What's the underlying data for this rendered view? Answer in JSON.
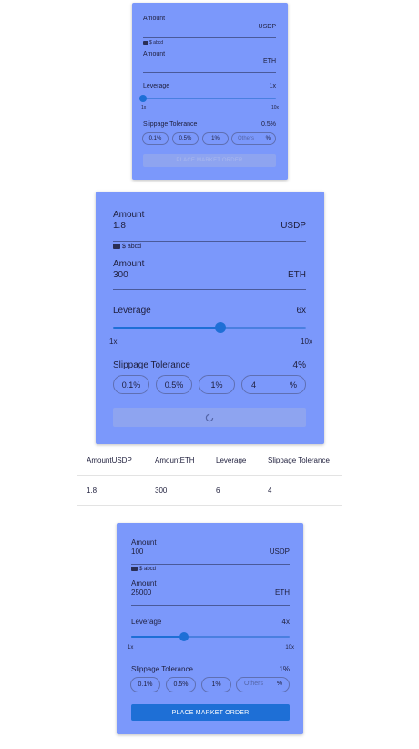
{
  "card1": {
    "amount1_label": "Amount",
    "amount1_value": "",
    "amount1_currency": "USDP",
    "wallet_text": "$ abcd",
    "amount2_label": "Amount",
    "amount2_value": "",
    "amount2_currency": "ETH",
    "leverage_label": "Leverage",
    "leverage_value": "1x",
    "leverage_level": 1,
    "slider_min": "1x",
    "slider_max": "10x",
    "slippage_label": "Slippage Tolerance",
    "slippage_value": "0.5%",
    "options": [
      "0.1%",
      "0.5%",
      "1%"
    ],
    "others_placeholder": "Others",
    "others_value": "",
    "percent_sign": "%",
    "button_label": "PLACE MARKET ORDER",
    "button_state": "disabled"
  },
  "card2": {
    "amount1_label": "Amount",
    "amount1_value": "1.8",
    "amount1_currency": "USDP",
    "wallet_text": "$ abcd",
    "amount2_label": "Amount",
    "amount2_value": "300",
    "amount2_currency": "ETH",
    "leverage_label": "Leverage",
    "leverage_value": "6x",
    "leverage_level": 6,
    "slider_min": "1x",
    "slider_max": "10x",
    "slippage_label": "Slippage Tolerance",
    "slippage_value": "4%",
    "options": [
      "0.1%",
      "0.5%",
      "1%"
    ],
    "others_placeholder": "Others",
    "others_value": "4",
    "percent_sign": "%",
    "button_state": "loading"
  },
  "results_table": {
    "headers": [
      "AmountUSDP",
      "AmountETH",
      "Leverage",
      "Slippage Tolerance"
    ],
    "rows": [
      [
        "1.8",
        "300",
        "6",
        "4"
      ]
    ]
  },
  "card3": {
    "amount1_label": "Amount",
    "amount1_value": "100",
    "amount1_currency": "USDP",
    "wallet_text": "$ abcd",
    "amount2_label": "Amount",
    "amount2_value": "25000",
    "amount2_currency": "ETH",
    "leverage_label": "Leverage",
    "leverage_value": "4x",
    "leverage_level": 4,
    "slider_min": "1x",
    "slider_max": "10x",
    "slippage_label": "Slippage Tolerance",
    "slippage_value": "1%",
    "options": [
      "0.1%",
      "0.5%",
      "1%"
    ],
    "others_placeholder": "Others",
    "others_value": "",
    "percent_sign": "%",
    "button_label": "PLACE MARKET ORDER",
    "button_state": "enabled"
  },
  "colors": {
    "card_bg": "#7b98fb",
    "accent": "#1e6fd6",
    "button_disabled": "#8ea4f0",
    "text": "#1e1e3c"
  }
}
